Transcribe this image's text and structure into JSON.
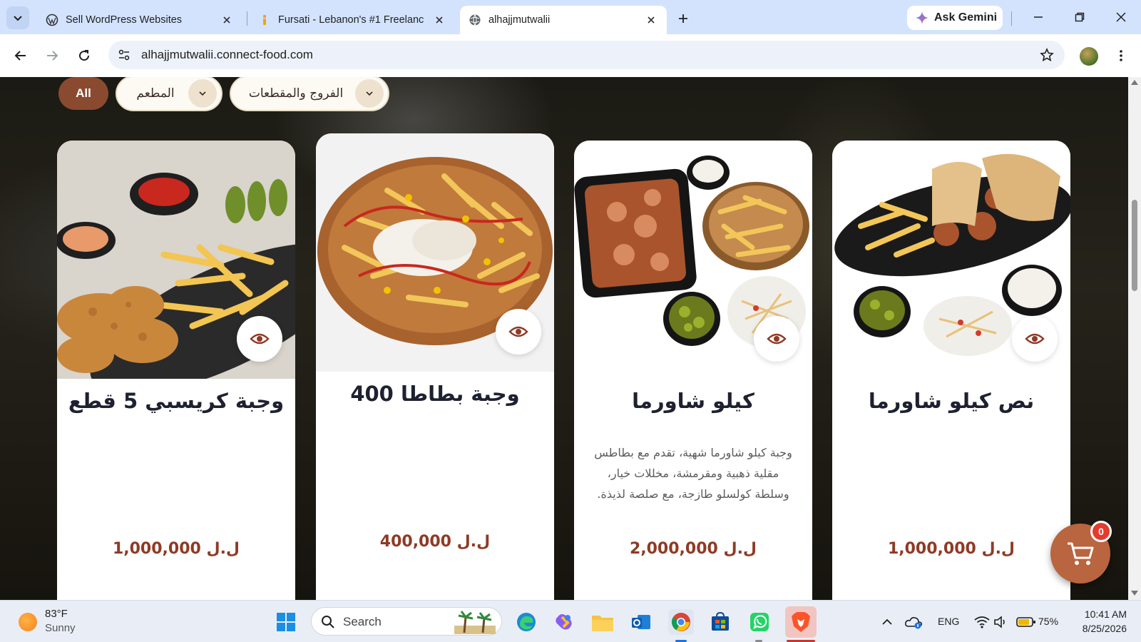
{
  "browser": {
    "tabs": [
      {
        "title": "Sell WordPress Websites",
        "favicon": "wordpress-icon"
      },
      {
        "title": "Fursati - Lebanon's #1 Freelanc",
        "favicon": "fursati-icon"
      },
      {
        "title": "alhajjmutwalii",
        "favicon": "globe-icon",
        "active": true
      }
    ],
    "gemini_label": "Ask Gemini",
    "url": "alhajjmutwalii.connect-food.com"
  },
  "page": {
    "filters": {
      "all_label": "All",
      "restaurant_label": "المطعم",
      "category_label": "الفروج والمقطعات"
    },
    "products": [
      {
        "name": "وجبة كريسبي 5 قطع",
        "description": "",
        "price": "1,000,000 ل.ل"
      },
      {
        "name": "وجبة بطاطا 400",
        "description": "",
        "price": "400,000 ل.ل"
      },
      {
        "name": "كيلو شاورما",
        "description": "وجبة كيلو شاورما شهية، تقدم مع بطاطس مقلية ذهبية ومقرمشة، مخللات خيار، وسلطة كولسلو طازجة، مع صلصة لذيذة.",
        "price": "2,000,000 ل.ل"
      },
      {
        "name": "نص كيلو شاورما",
        "description": "",
        "price": "1,000,000 ل.ل"
      }
    ],
    "cart_count": "0",
    "accent_color": "#8f3a25"
  },
  "taskbar": {
    "weather_temp": "83°F",
    "weather_condition": "Sunny",
    "search_placeholder": "Search",
    "language": "ENG",
    "battery": "75%",
    "time": "10:41 AM",
    "date": "8/25/2026"
  }
}
